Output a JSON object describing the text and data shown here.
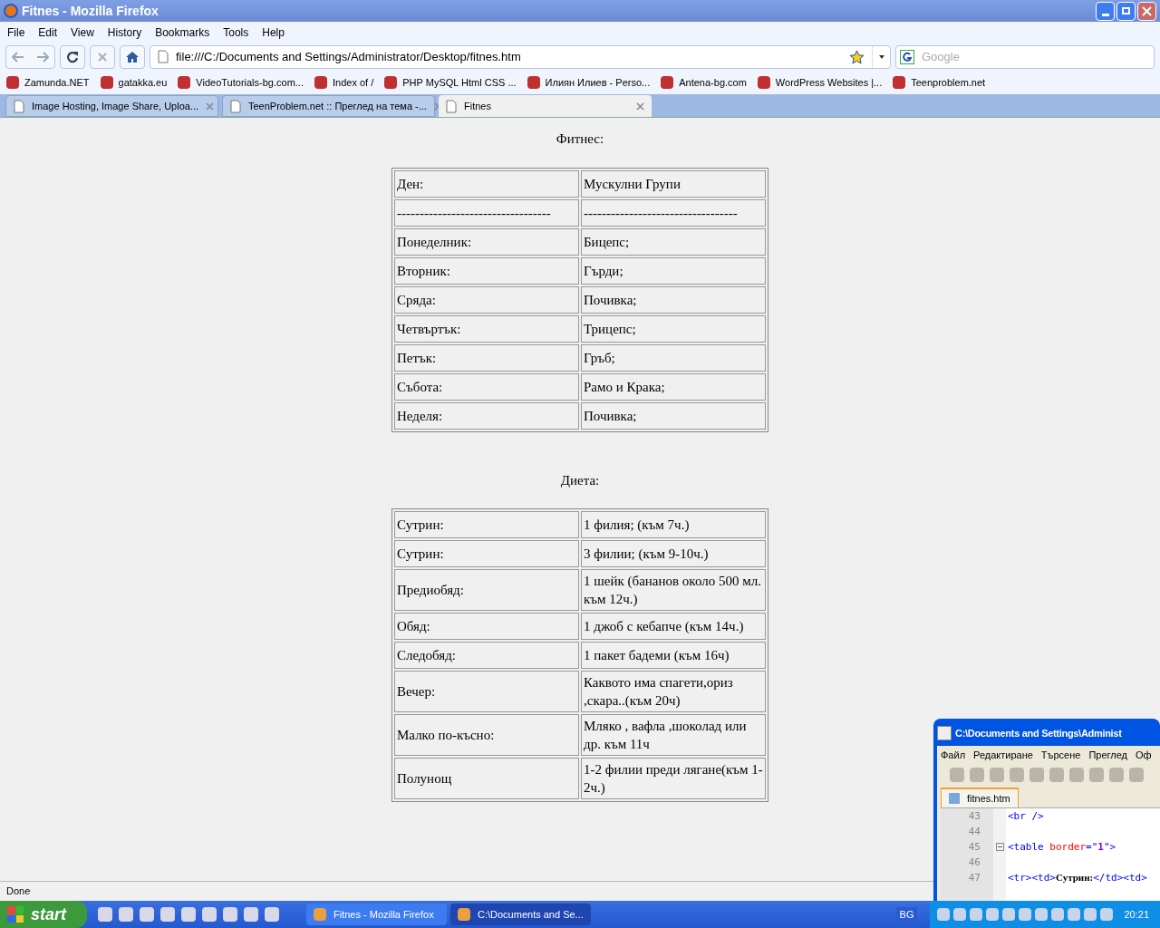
{
  "window": {
    "title": "Fitnes - Mozilla Firefox"
  },
  "menu": [
    "File",
    "Edit",
    "View",
    "History",
    "Bookmarks",
    "Tools",
    "Help"
  ],
  "address": {
    "value": "file:///C:/Documents and Settings/Administrator/Desktop/fitnes.htm"
  },
  "search": {
    "placeholder": "Google"
  },
  "bookmarks": [
    {
      "label": "Zamunda.NET"
    },
    {
      "label": "gatakka.eu"
    },
    {
      "label": "VideoTutorials-bg.com..."
    },
    {
      "label": "Index of /"
    },
    {
      "label": "PHP MySQL Html CSS ..."
    },
    {
      "label": "Илиян Илиев - Perso..."
    },
    {
      "label": "Antena-bg.com"
    },
    {
      "label": "WordPress Websites |..."
    },
    {
      "label": "Teenproblem.net"
    }
  ],
  "tabs": [
    {
      "label": "Image Hosting, Image Share, Uploa...",
      "selected": false
    },
    {
      "label": "TeenProblem.net :: Преглед на тема -...",
      "selected": false
    },
    {
      "label": "Fitnes",
      "selected": true
    }
  ],
  "page": {
    "sections": [
      {
        "heading": "Фитнес:",
        "rows": [
          [
            "Ден:",
            "Мускулни Групи"
          ],
          [
            "----------------------------------",
            "----------------------------------"
          ],
          [
            "Понеделник:",
            "Бицепс;"
          ],
          [
            "Вторник:",
            "Гърди;"
          ],
          [
            "Сряда:",
            "Почивка;"
          ],
          [
            "Четвъртък:",
            "Трицепс;"
          ],
          [
            "Петък:",
            "Гръб;"
          ],
          [
            "Събота:",
            "Рамо и Крака;"
          ],
          [
            "Неделя:",
            "Почивка;"
          ]
        ]
      },
      {
        "heading": "Диета:",
        "rows": [
          [
            "Сутрин:",
            "1 филия; (към 7ч.)"
          ],
          [
            "Сутрин:",
            "3 филии; (към 9-10ч.)"
          ],
          [
            "Предиобяд:",
            "1 шейк (бананов около 500 мл. към 12ч.)"
          ],
          [
            "Обяд:",
            "1 джоб с кебапче (към 14ч.)"
          ],
          [
            "Следобяд:",
            "1 пакет бадеми (към 16ч)"
          ],
          [
            "Вечер:",
            "Каквото има спагети,ориз ,скара..(към 20ч)"
          ],
          [
            "Малко по-късно:",
            "Мляко , вафла ,шоколад или др. към 11ч"
          ],
          [
            "Полунощ",
            "1-2 филии преди лягане(към 1-2ч.)"
          ]
        ]
      }
    ]
  },
  "status_bar": "Done",
  "editor": {
    "title": "C:\\Documents and Settings\\Administ",
    "menu": [
      "Файл",
      "Редактиране",
      "Търсене",
      "Преглед",
      "Оф"
    ],
    "tab": "fitnes.htm",
    "lines": [
      {
        "number": "43",
        "tokens": [
          {
            "kind": "tag",
            "text": "<br />"
          }
        ]
      },
      {
        "number": "44"
      },
      {
        "number": "45",
        "fold": true,
        "tokens": [
          {
            "kind": "tag",
            "text": "<table "
          },
          {
            "kind": "attr",
            "text": "border"
          },
          {
            "kind": "tag",
            "text": "=\""
          },
          {
            "kind": "value",
            "text": "1"
          },
          {
            "kind": "tag",
            "text": "\">"
          }
        ]
      },
      {
        "number": "46"
      },
      {
        "number": "47",
        "tokens": [
          {
            "kind": "tag",
            "text": "<tr><td>"
          },
          {
            "kind": "text",
            "text": "Сутрин:"
          },
          {
            "kind": "tag",
            "text": "</td><td>"
          }
        ]
      }
    ]
  },
  "taskbar": {
    "start": "start",
    "windows": [
      {
        "label": "Fitnes - Mozilla Firefox",
        "selected": false
      },
      {
        "label": "C:\\Documents and Se...",
        "selected": true
      }
    ],
    "language": "BG",
    "clock": "20:21"
  }
}
